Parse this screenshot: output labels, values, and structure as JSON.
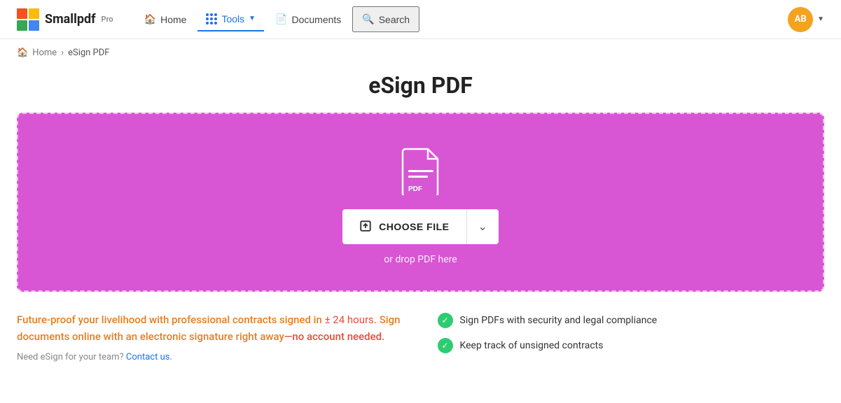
{
  "brand": {
    "logo_text": "Smallpdf",
    "logo_pro": "Pro"
  },
  "navbar": {
    "home_label": "Home",
    "tools_label": "Tools",
    "documents_label": "Documents",
    "search_label": "Search",
    "avatar_initials": "AB"
  },
  "breadcrumb": {
    "home": "Home",
    "separator": "›",
    "current": "eSign PDF"
  },
  "page": {
    "title": "eSign PDF"
  },
  "dropzone": {
    "choose_file_label": "CHOOSE FILE",
    "drop_hint": "or drop PDF here"
  },
  "info": {
    "text_part1": "Future-proof your livelihood with professional contracts signed in",
    "text_highlight": " ± 24 hours",
    "text_part2": ". Sign documents online with an electronic signature right away",
    "text_part3": "—no account needed.",
    "need_team_text": "Need eSign for your team?",
    "contact_link": "Contact us."
  },
  "features": [
    {
      "text": "Sign PDFs with security and legal compliance"
    },
    {
      "text": "Keep track of unsigned contracts"
    }
  ]
}
